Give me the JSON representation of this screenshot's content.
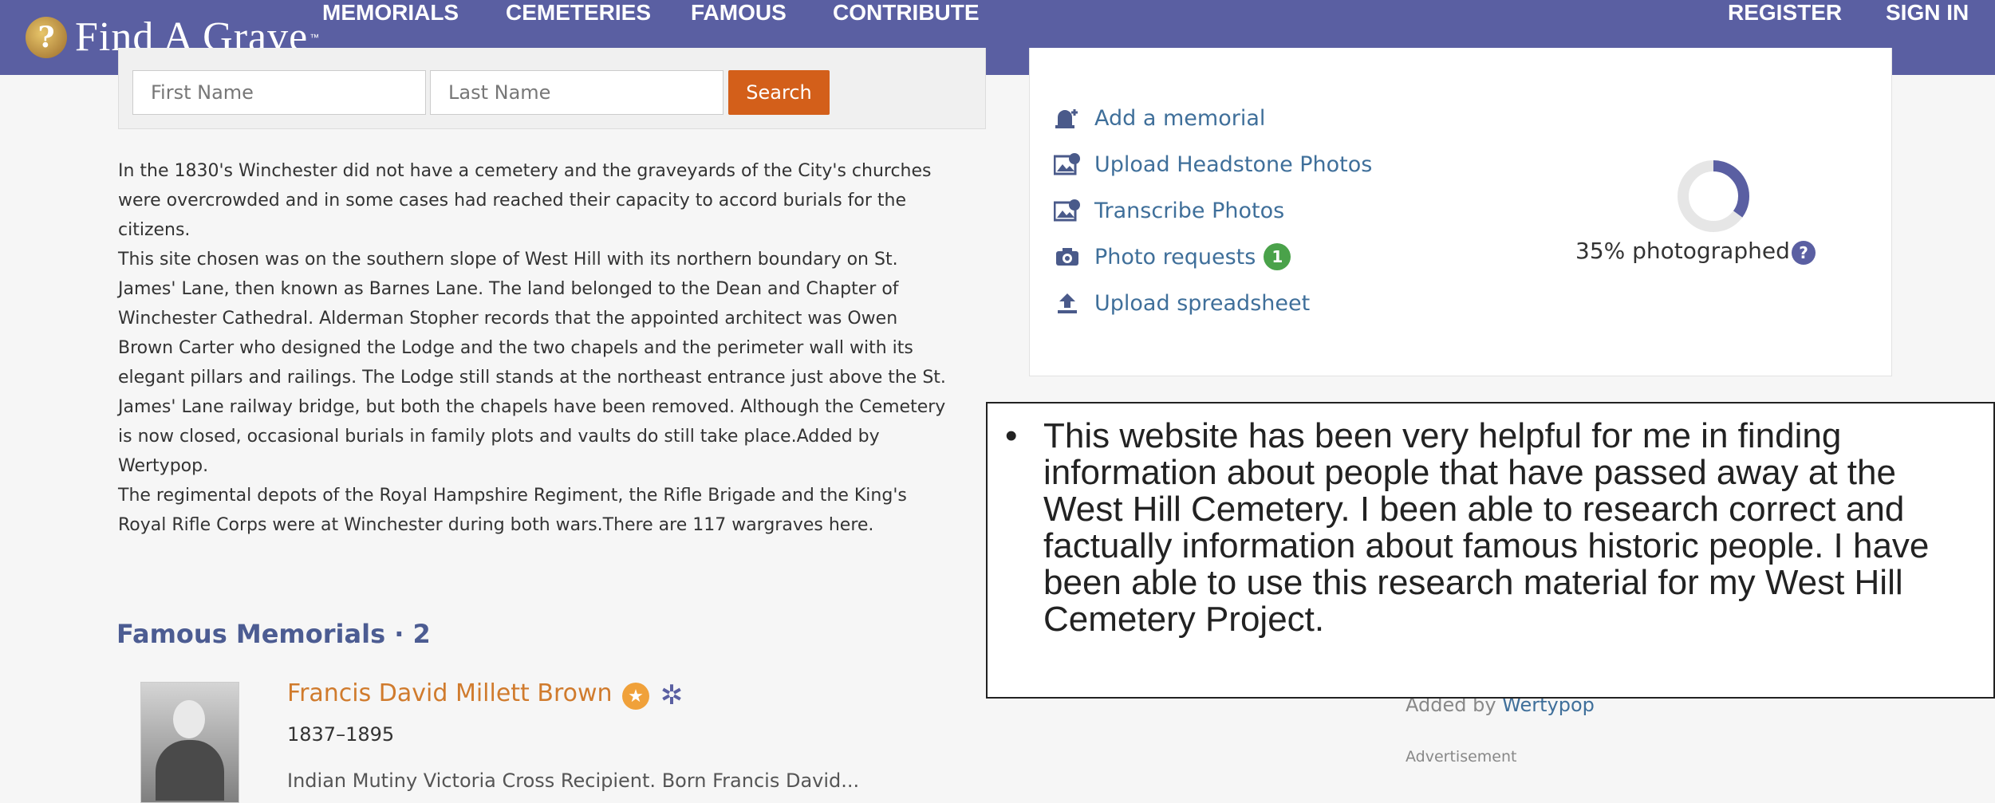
{
  "navbar": {
    "logo_text": "Find A Grave",
    "logo_tm": "™",
    "items": [
      "MEMORIALS",
      "CEMETERIES",
      "FAMOUS",
      "CONTRIBUTE"
    ],
    "active_item": "CEMETERIES",
    "register": "REGISTER",
    "sign_in": "SIGN IN"
  },
  "search": {
    "first_name_placeholder": "First Name",
    "last_name_placeholder": "Last Name",
    "button_label": "Search"
  },
  "description": "In the 1830's Winchester did not have a cemetery and the graveyards of the City's churches\nwere overcrowded and in some cases had reached their capacity to accord burials for the\ncitizens.\nThis site chosen was on the southern slope of West Hill with its northern boundary on St.\nJames' Lane, then known as Barnes Lane. The land belonged to the Dean and Chapter of\nWinchester Cathedral. Alderman Stopher records that the appointed architect was Owen\nBrown Carter who designed the Lodge and the two chapels and the perimeter wall with its\nelegant pillars and railings. The Lodge still stands at the northeast entrance just above the St.\nJames' Lane railway bridge, but both the chapels have been removed. Although the Cemetery\nis now closed, occasional burials in family plots and vaults do still take place.Added by\nWertypop.\nThe regimental depots of the Royal Hampshire Regiment, the Rifle Brigade and the King's\nRoyal Rifle Corps were at Winchester during both wars.There are 117 wargraves here.",
  "famous": {
    "heading": "Famous Memorials · 2",
    "memorial": {
      "name": "Francis David Millett Brown",
      "dates": "1837–1895",
      "summary": "Indian Mutiny Victoria Cross Recipient. Born Francis David..."
    }
  },
  "actions": {
    "items": [
      {
        "label": "Add a memorial",
        "icon": "add-memorial-icon"
      },
      {
        "label": "Upload Headstone Photos",
        "icon": "upload-photo-icon"
      },
      {
        "label": "Transcribe Photos",
        "icon": "transcribe-photo-icon"
      },
      {
        "label": "Photo requests",
        "icon": "camera-icon",
        "badge": "1"
      },
      {
        "label": "Upload spreadsheet",
        "icon": "upload-icon"
      }
    ],
    "photographed_label": "35% photographed",
    "photographed_fraction": 0.35
  },
  "added_by": {
    "prefix": "Added by ",
    "user": "Wertypop"
  },
  "advertisement": "Advertisement",
  "comment": {
    "bullet": "•",
    "text": "This website has been very helpful for me in finding information about people that have passed away at the West Hill Cemetery. I been able to research correct and factually information about famous historic people. I have been able to use this research material for my West Hill Cemetery Project."
  },
  "colors": {
    "nav_bg": "#5a5fa2",
    "search_button": "#d35f1a",
    "link": "#3f6f9a",
    "memorial_name": "#d07b2d",
    "badge_green": "#4aa24a"
  }
}
